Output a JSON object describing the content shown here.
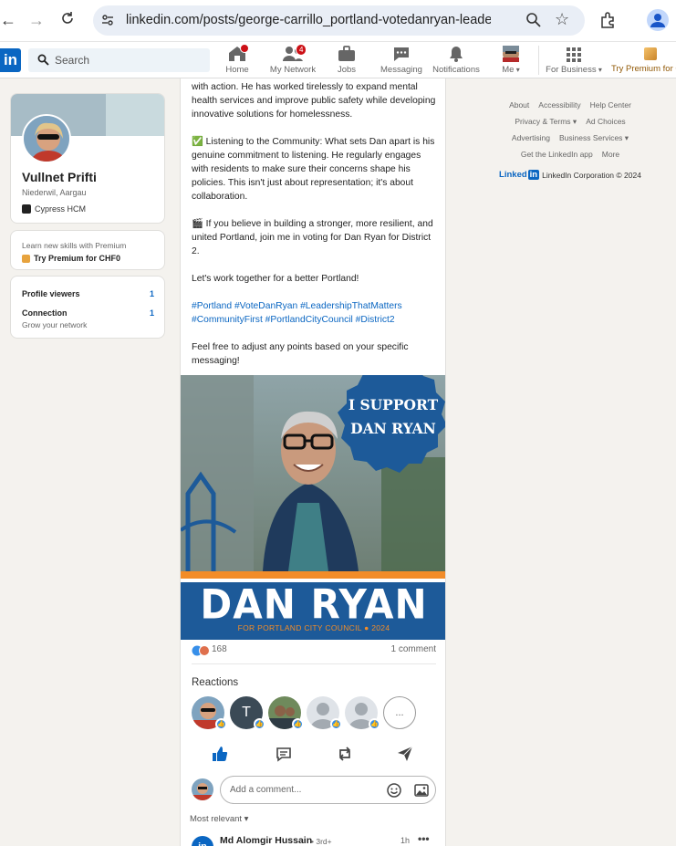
{
  "browser": {
    "url": "linkedin.com/posts/george-carrillo_portland-votedanryan-leadersh..."
  },
  "nav": {
    "logo": "in",
    "search_placeholder": "Search",
    "items": [
      {
        "label": "Home",
        "badge": ""
      },
      {
        "label": "My Network",
        "badge": "4"
      },
      {
        "label": "Jobs",
        "badge": ""
      },
      {
        "label": "Messaging",
        "badge": ""
      },
      {
        "label": "Notifications",
        "badge": ""
      },
      {
        "label": "Me",
        "badge": ""
      },
      {
        "label": "For Business",
        "badge": ""
      }
    ],
    "premium": "Try Premium for C"
  },
  "profile": {
    "name": "Vullnet Prifti",
    "location": "Niederwil, Aargau",
    "company": "Cypress HCM"
  },
  "premium_card": {
    "line1": "Learn new skills with Premium",
    "line2": "Try Premium for CHF0"
  },
  "stats": {
    "viewers_label": "Profile viewers",
    "viewers_value": "1",
    "connection_label": "Connection",
    "connection_value": "1",
    "grow": "Grow your network"
  },
  "post": {
    "p1": "with action. He has worked tirelessly to expand mental health services and improve public safety while developing innovative solutions for homelessness.",
    "p2": "✅ Listening to the Community: What sets Dan apart is his genuine commitment to listening. He regularly engages with residents to make sure their concerns shape his policies. This isn't just about representation; it's about collaboration.",
    "p3": "🎬 If you believe in building a stronger, more resilient, and united Portland, join me in voting for Dan Ryan for District 2.",
    "p4": "Let's work together for a better Portland!",
    "hashtags1": "#Portland #VoteDanRyan #LeadershipThatMatters",
    "hashtags2": "#CommunityFirst #PortlandCityCouncil #District2",
    "p5": "Feel free to adjust any points based on your specific messaging!",
    "image": {
      "badge_line1": "I SUPPORT",
      "badge_line2": "DAN RYAN",
      "name": "DAN RYAN",
      "sub": "FOR PORTLAND CITY COUNCIL",
      "year": "2024"
    },
    "reactions_count": "168",
    "comments": "1 comment",
    "reactions_label": "Reactions",
    "reactor_initial": "T",
    "more": "...",
    "comment_placeholder": "Add a comment...",
    "sort": "Most relevant",
    "commenter": {
      "avatar": "in",
      "name": "Md Alomgir Hussain",
      "degree": "• 3rd+",
      "time": "1h",
      "more": "•••"
    }
  },
  "footer": {
    "links": [
      "About",
      "Accessibility",
      "Help Center",
      "Privacy & Terms",
      "Ad Choices",
      "Advertising",
      "Business Services",
      "Get the LinkedIn app",
      "More"
    ],
    "brand": "Linked",
    "brand_in": "in",
    "copyright": "LinkedIn Corporation © 2024"
  },
  "colors": {
    "brand": "#0a66c2",
    "poster_blue": "#1d5a99",
    "poster_orange": "#f28c28"
  }
}
